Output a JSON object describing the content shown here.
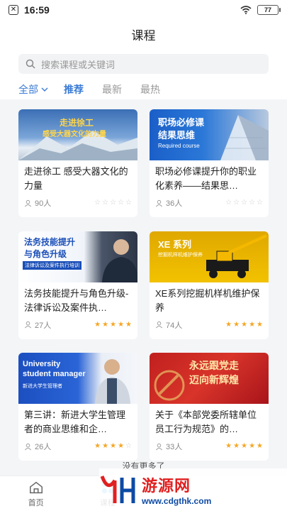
{
  "status": {
    "time": "16:59",
    "battery": "77"
  },
  "header": {
    "title": "课程"
  },
  "search": {
    "placeholder": "搜索课程或关键词"
  },
  "filters": {
    "all_label": "全部",
    "tabs": [
      "推荐",
      "最新",
      "最热"
    ],
    "active_tab": "推荐"
  },
  "courses": [
    {
      "title": "走进徐工 感受大器文化的力量",
      "learners": "90人",
      "rating": 0,
      "thumb_lines": [
        "走进徐工",
        "感受大器文化的力量"
      ]
    },
    {
      "title": "职场必修课提升你的职业化素养——结果思…",
      "learners": "36人",
      "rating": 0,
      "thumb_lines": [
        "职场必修课",
        "结果思维",
        "Required course"
      ]
    },
    {
      "title": "法务技能提升与角色升级-法律诉讼及案件执…",
      "learners": "27人",
      "rating": 5,
      "thumb_lines": [
        "法务技能提升",
        "与角色升级",
        "法律诉讼及案件执行培训"
      ]
    },
    {
      "title": "XE系列挖掘机样机维护保养",
      "learners": "74人",
      "rating": 5,
      "thumb_lines": [
        "XE 系列",
        "挖掘机样机维护保养"
      ]
    },
    {
      "title": "第三讲：新进大学生管理者的商业思维和企…",
      "learners": "26人",
      "rating": 4,
      "thumb_lines": [
        "University",
        "student manager",
        "新进大学生管理者"
      ]
    },
    {
      "title": "关于《本部党委所辖单位员工行为规范》的…",
      "learners": "33人",
      "rating": 5,
      "thumb_lines": [
        "永远跟党走",
        "迈向新辉煌"
      ]
    }
  ],
  "footer": {
    "no_more": "没有更多了"
  },
  "tabbar": {
    "items": [
      {
        "label": "首页"
      },
      {
        "label": "课程"
      }
    ]
  },
  "watermark": {
    "title": "游源网",
    "url": "www.cdgthk.com"
  },
  "colors": {
    "accent": "#3a7bd5",
    "star": "#f5a623"
  }
}
